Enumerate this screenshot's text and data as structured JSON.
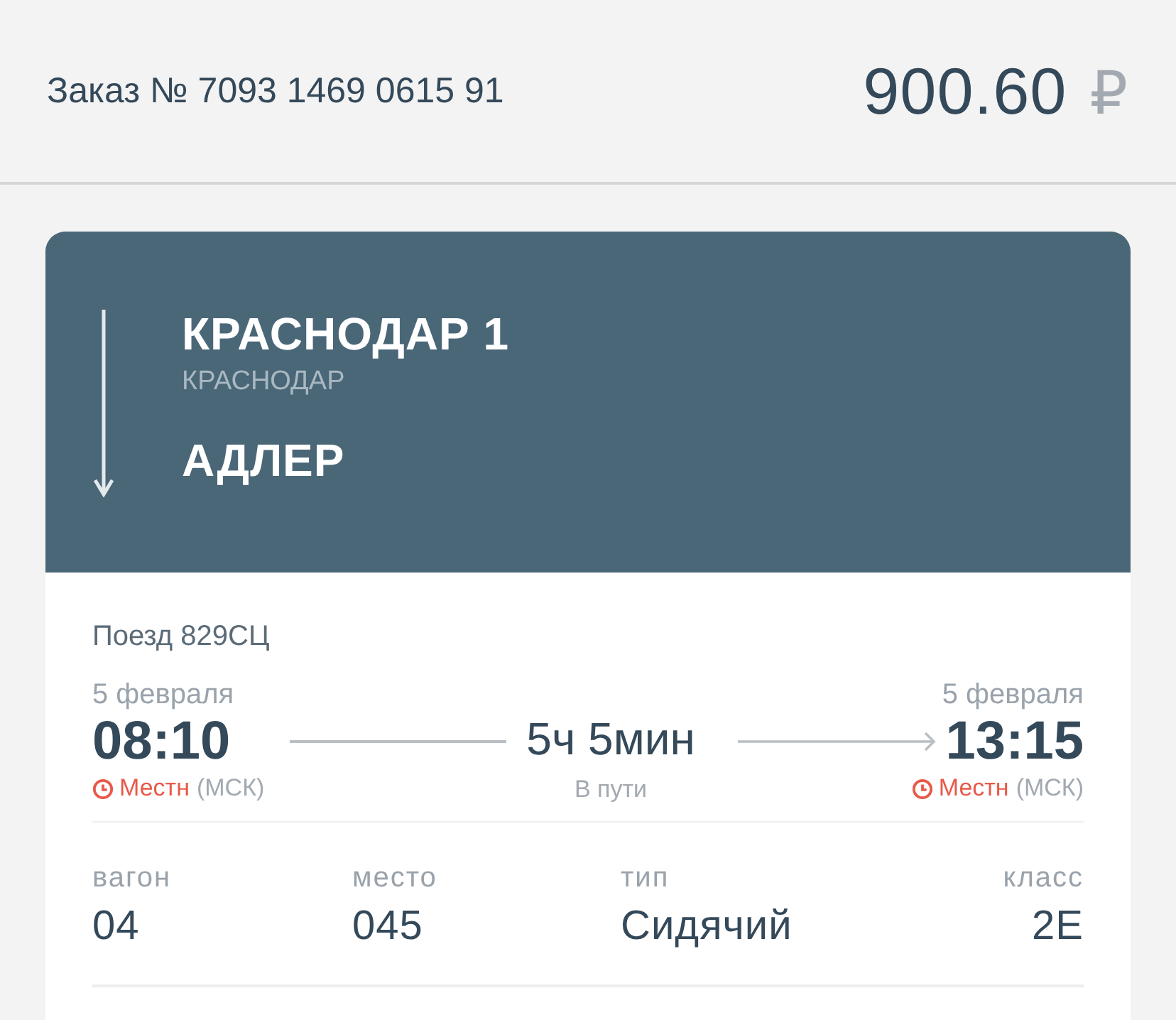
{
  "order": {
    "label": "Заказ № 7093 1469 0615 91",
    "price": "900.60",
    "currency": "₽"
  },
  "route": {
    "from_station": "КРАСНОДАР 1",
    "from_city": "КРАСНОДАР",
    "to_station": "АДЛЕР"
  },
  "train": "Поезд 829СЦ",
  "departure": {
    "date": "5 февраля",
    "time": "08:10",
    "zone_label": "Местн",
    "zone": "(МСК)"
  },
  "duration": {
    "value": "5ч 5мин",
    "label": "В пути"
  },
  "arrival": {
    "date": "5 февраля",
    "time": "13:15",
    "zone_label": "Местн",
    "zone": "(МСК)"
  },
  "details": [
    {
      "label": "вагон",
      "value": "04"
    },
    {
      "label": "место",
      "value": "045"
    },
    {
      "label": "тип",
      "value": "Сидячий"
    },
    {
      "label": "класс",
      "value": "2Е"
    }
  ]
}
